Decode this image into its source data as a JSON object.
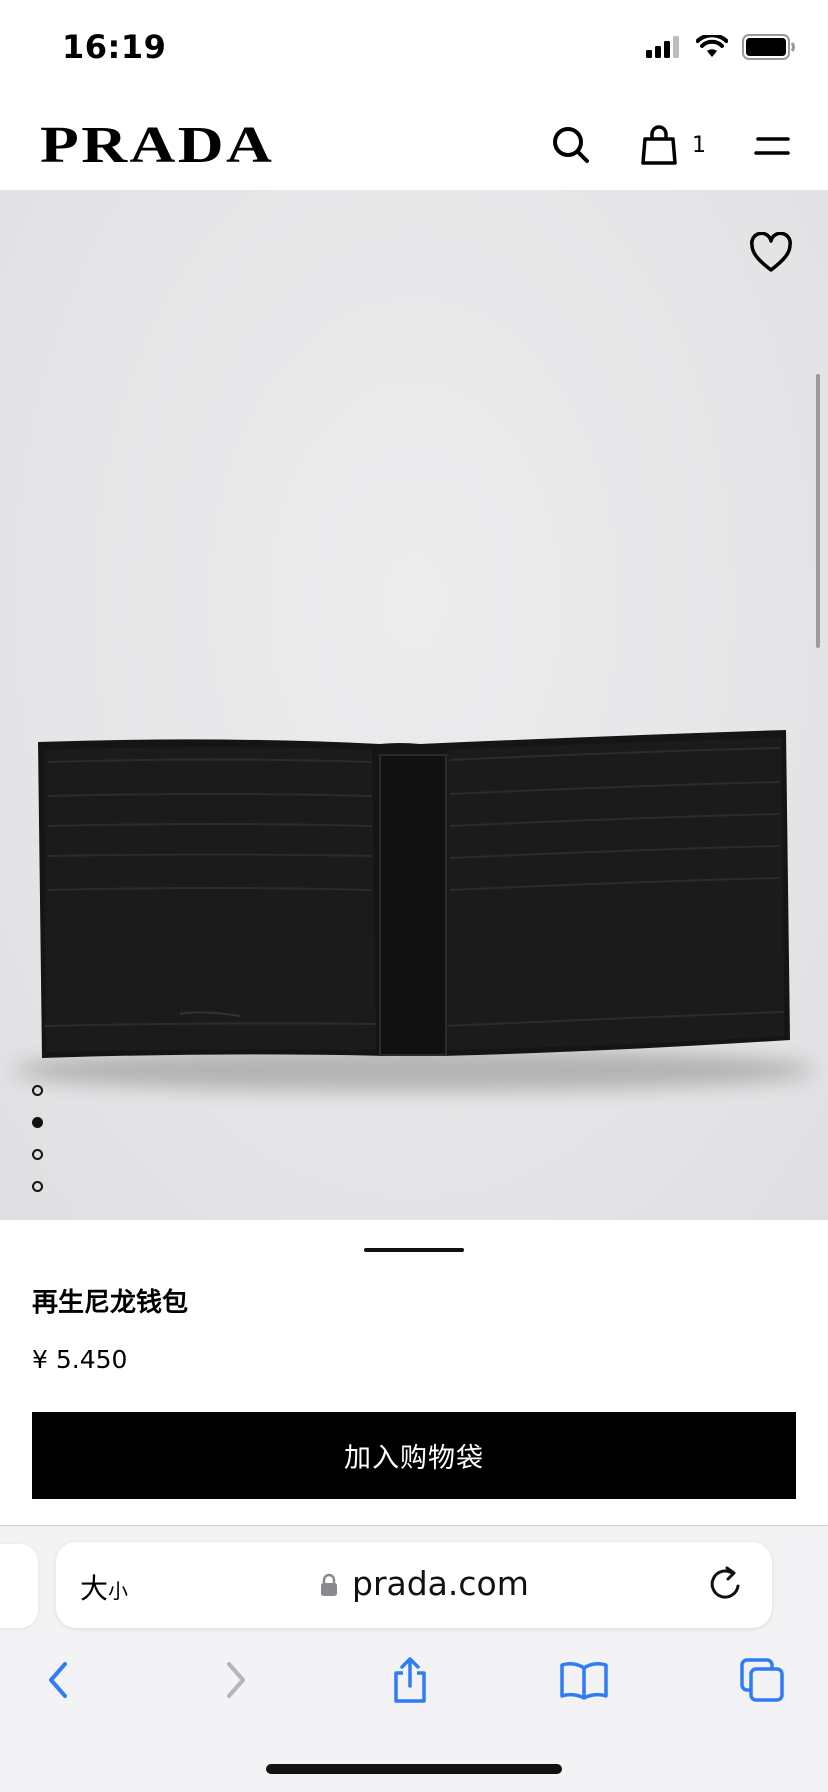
{
  "status_bar": {
    "time": "16:19"
  },
  "header": {
    "brand": "PRADA",
    "bag_count": "1"
  },
  "product": {
    "name": "再生尼龙钱包",
    "price": "¥ 5.450",
    "add_to_bag_label": "加入购物袋"
  },
  "gallery": {
    "image_count": 4,
    "active_index": 1
  },
  "browser": {
    "text_size_label_large": "大",
    "text_size_label_small": "小",
    "url": "prada.com"
  },
  "colors": {
    "accent": "#000000",
    "safari_blue": "#2f7cf6",
    "hero_bg": "#e6e6e8"
  },
  "icons": [
    "signal-icon",
    "wifi-icon",
    "battery-icon",
    "search-icon",
    "shopping-bag-icon",
    "menu-icon",
    "heart-icon",
    "lock-icon",
    "reload-icon",
    "back-icon",
    "forward-icon",
    "share-icon",
    "bookmarks-icon",
    "tabs-icon"
  ]
}
